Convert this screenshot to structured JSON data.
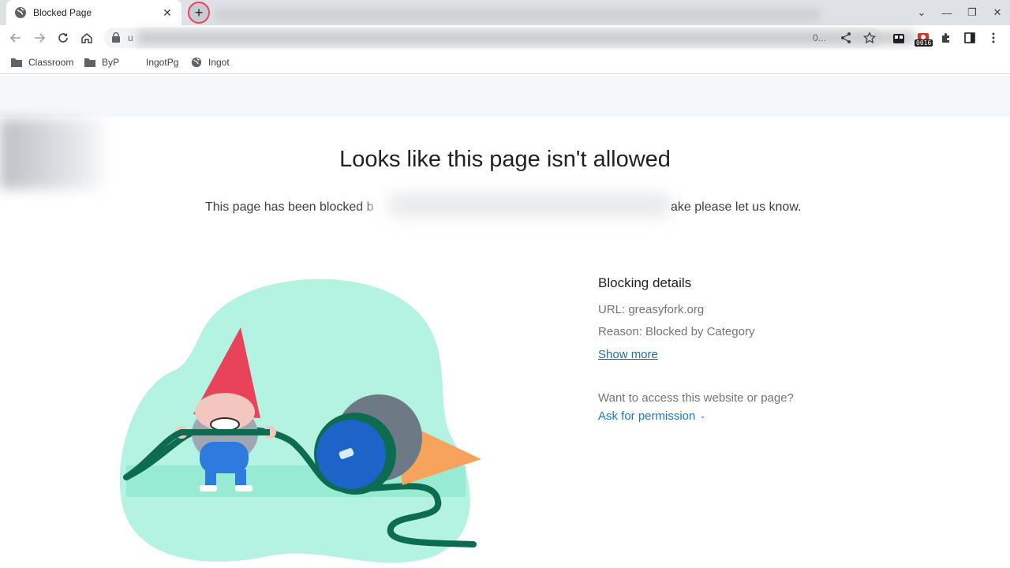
{
  "browser": {
    "tab": {
      "title": "Blocked Page",
      "close_glyph": "✕"
    },
    "new_tab_glyph": "+",
    "window_controls": {
      "tab_search": "⌄",
      "minimize": "—",
      "restore": "❐",
      "close": "✕"
    },
    "omnibox": {
      "url_start": "u",
      "url_end": "0..."
    },
    "extension_badge": "0016",
    "bookmarks": [
      {
        "label": "Classroom",
        "icon": "folder-icon"
      },
      {
        "label": "ByP",
        "icon": "folder-icon"
      },
      {
        "label": "IngotPg",
        "icon": "none"
      },
      {
        "label": "Ingot",
        "icon": "globe-icon"
      }
    ]
  },
  "page": {
    "heading": "Looks like this page isn't allowed",
    "message_start": "This page has been blocked b",
    "message_end": "ake please let us know.",
    "details": {
      "title": "Blocking details",
      "url_line": "URL: greasyfork.org",
      "reason_line": "Reason: Blocked by Category",
      "show_more": "Show more",
      "access_question": "Want to access this website or page?",
      "ask_permission": "Ask for permission",
      "ask_chevron": "⌄"
    }
  },
  "colors": {
    "link": "#1f77c9",
    "blob": "#b4f2e1",
    "hose": "#0d6b4f",
    "gnome_hat": "#e8435a",
    "gnome_body": "#2e7be0"
  }
}
